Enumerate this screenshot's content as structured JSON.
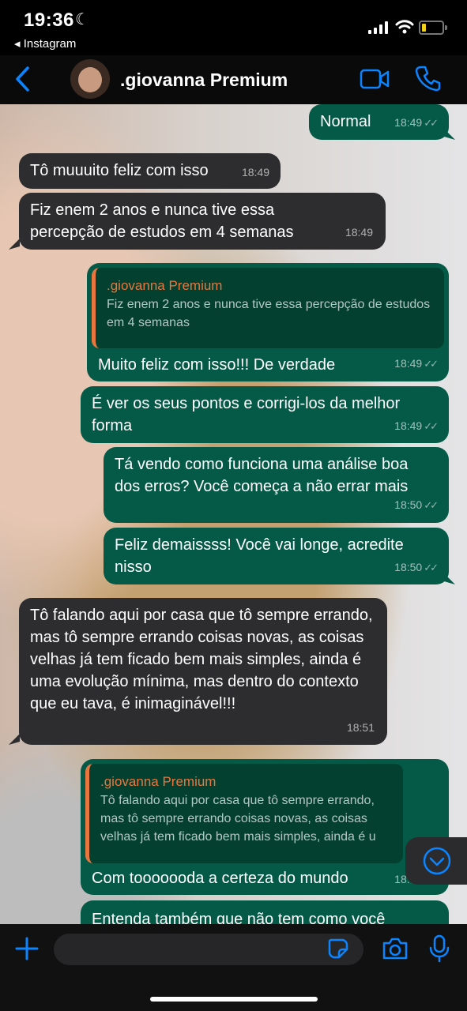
{
  "status": {
    "time": "19:36",
    "back_app": "◂ Instagram",
    "battery_percent": 18
  },
  "header": {
    "contact_name": ".giovanna Premium"
  },
  "messages": [
    {
      "text": "Normal",
      "time": "18:49",
      "status": "read"
    },
    {
      "text": "Tô muuuito feliz com isso",
      "time": "18:49"
    },
    {
      "text": "Fiz enem 2 anos e nunca tive essa percepção de estudos em 4 semanas",
      "time": "18:49"
    },
    {
      "quote_name": ".giovanna Premium",
      "quote_text": "Fiz enem 2 anos e nunca tive essa percepção de estudos em 4 semanas",
      "text": "Muito feliz com isso!!! De verdade",
      "time": "18:49"
    },
    {
      "text": "É ver os seus pontos e corrigi-los da melhor forma",
      "time": "18:49"
    },
    {
      "text": "Tá vendo como funciona uma análise boa dos erros? Você começa a não errar mais",
      "time": "18:50"
    },
    {
      "text": "Feliz demaissss! Você vai longe, acredite nisso",
      "time": "18:50"
    },
    {
      "text": "Tô falando aqui por casa que tô sempre errando, mas tô sempre errando coisas novas, as coisas velhas já tem ficado bem mais simples, ainda é uma evolução mínima, mas dentro do contexto que eu tava, é inimaginável!!!",
      "time": "18:51"
    },
    {
      "quote_name": ".giovanna Premium",
      "quote_text": "Tô falando aqui por casa que tô sempre errando, mas tô sempre errando coisas novas, as coisas velhas já tem ficado bem mais simples, ainda é u",
      "text": "Com tooooooda a certeza do mundo",
      "time": "18:52"
    },
    {
      "text": "Entenda também que não tem como você"
    }
  ],
  "icons": {
    "back": "chevron-left-icon",
    "video": "video-call-icon",
    "call": "phone-icon",
    "plus": "plus-icon",
    "sticker": "sticker-icon",
    "camera": "camera-icon",
    "mic": "microphone-icon",
    "scroll": "chevron-down-circle-icon"
  },
  "colors": {
    "accent": "#0a84ff",
    "outgoing": "#055a47",
    "incoming": "#2d2d2f",
    "quote_name": "#e8773f"
  }
}
